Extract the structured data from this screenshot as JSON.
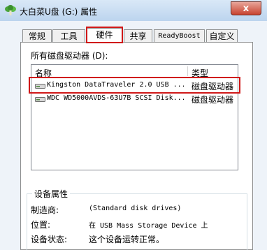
{
  "window": {
    "title": "大白菜U盘 (G:) 属性",
    "close_label": "x"
  },
  "tabs": [
    {
      "label": "常规",
      "active": false
    },
    {
      "label": "工具",
      "active": false
    },
    {
      "label": "硬件",
      "active": true
    },
    {
      "label": "共享",
      "active": false
    },
    {
      "label": "ReadyBoost",
      "active": false
    },
    {
      "label": "自定义",
      "active": false
    }
  ],
  "hardware": {
    "list_label": "所有磁盘驱动器 (D):",
    "columns": {
      "name": "名称",
      "type": "类型"
    },
    "rows": [
      {
        "name": "Kingston DataTraveler 2.0 USB ...",
        "type": "磁盘驱动器",
        "selected": true
      },
      {
        "name": "WDC WD5000AVDS-63U7B SCSI Disk...",
        "type": "磁盘驱动器",
        "selected": false
      }
    ]
  },
  "properties": {
    "group_title": "设备属性",
    "manufacturer_label": "制造商:",
    "manufacturer_value": "(Standard disk drives)",
    "location_label": "位置:",
    "location_value": "在 USB Mass Storage Device 上",
    "status_label": "设备状态:",
    "status_value": "这个设备运转正常。"
  },
  "colors": {
    "highlight": "#d01818",
    "title_bar": "#bcd4ee",
    "close_button": "#c8432f"
  },
  "icons": [
    "cabbage-app-icon",
    "disk-drive-icon"
  ]
}
